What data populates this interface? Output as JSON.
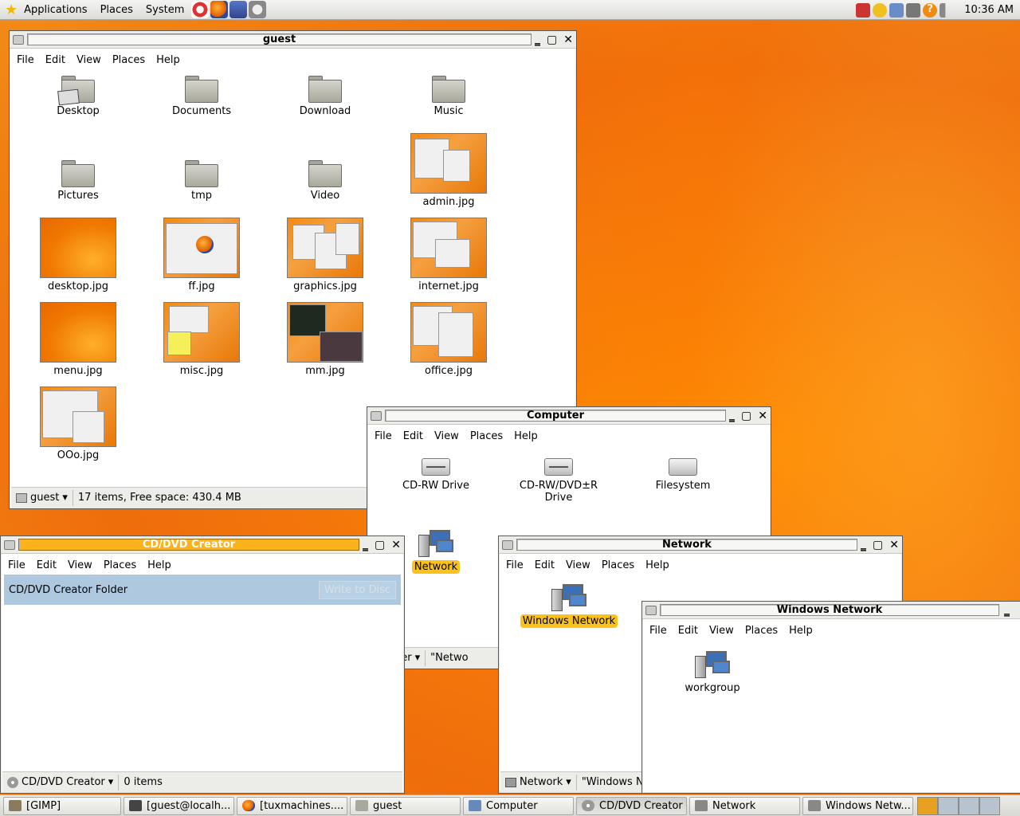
{
  "top_panel": {
    "menus": [
      "Applications",
      "Places",
      "System"
    ],
    "clock": "10:36 AM"
  },
  "guest_window": {
    "title": "guest",
    "menu": [
      "File",
      "Edit",
      "View",
      "Places",
      "Help"
    ],
    "items": [
      {
        "name": "Desktop",
        "kind": "folder"
      },
      {
        "name": "Documents",
        "kind": "folder"
      },
      {
        "name": "Download",
        "kind": "folder"
      },
      {
        "name": "Music",
        "kind": "folder"
      },
      {
        "name": "Pictures",
        "kind": "folder"
      },
      {
        "name": "tmp",
        "kind": "folder"
      },
      {
        "name": "Video",
        "kind": "folder"
      },
      {
        "name": "admin.jpg",
        "kind": "image"
      },
      {
        "name": "desktop.jpg",
        "kind": "image"
      },
      {
        "name": "ff.jpg",
        "kind": "image"
      },
      {
        "name": "graphics.jpg",
        "kind": "image"
      },
      {
        "name": "internet.jpg",
        "kind": "image"
      },
      {
        "name": "menu.jpg",
        "kind": "image"
      },
      {
        "name": "misc.jpg",
        "kind": "image"
      },
      {
        "name": "mm.jpg",
        "kind": "image"
      },
      {
        "name": "office.jpg",
        "kind": "image"
      },
      {
        "name": "OOo.jpg",
        "kind": "image"
      }
    ],
    "status_location": "guest",
    "status_info": "17 items, Free space: 430.4 MB"
  },
  "computer_window": {
    "title": "Computer",
    "menu": [
      "File",
      "Edit",
      "View",
      "Places",
      "Help"
    ],
    "items": [
      "CD-RW Drive",
      "CD-RW/DVD±R Drive",
      "Filesystem",
      "Network"
    ],
    "status_location": "mputer",
    "status_info": "\"Netwo"
  },
  "cddvd_window": {
    "title": "CD/DVD Creator",
    "menu": [
      "File",
      "Edit",
      "View",
      "Places",
      "Help"
    ],
    "folder_label": "CD/DVD Creator Folder",
    "write_button": "Write to Disc",
    "status_location": "CD/DVD Creator",
    "status_info": "0 items"
  },
  "network_window": {
    "title": "Network",
    "menu": [
      "File",
      "Edit",
      "View",
      "Places",
      "Help"
    ],
    "items": [
      "Windows Network"
    ],
    "status_location": "Network",
    "status_info": "\"Windows N"
  },
  "windows_network_window": {
    "title": "Windows Network",
    "menu": [
      "File",
      "Edit",
      "View",
      "Places",
      "Help"
    ],
    "items": [
      "workgroup"
    ]
  },
  "taskbar": {
    "tasks": [
      "[GIMP]",
      "[guest@localh...",
      "[tuxmachines....",
      "guest",
      "Computer",
      "CD/DVD Creator",
      "Network",
      "Windows Netw..."
    ]
  }
}
